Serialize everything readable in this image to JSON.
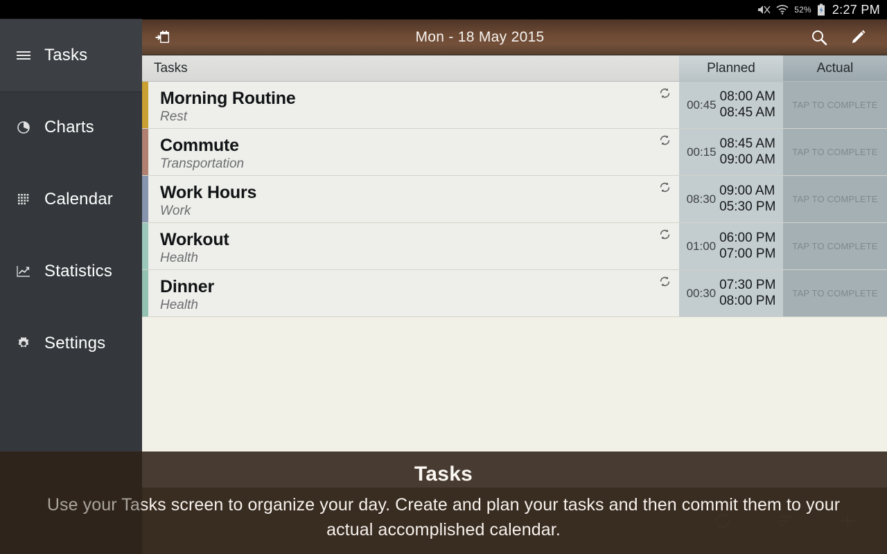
{
  "status_bar": {
    "mute_icon": "mute-icon",
    "wifi_icon": "wifi-icon",
    "battery_percent": "52%",
    "battery_icon": "battery-charging-icon",
    "clock": "2:27 PM"
  },
  "sidebar": {
    "items": [
      {
        "label": "Tasks",
        "icon": "hamburger-menu-icon",
        "active": true
      },
      {
        "label": "Charts",
        "icon": "pie-chart-icon",
        "active": false
      },
      {
        "label": "Calendar",
        "icon": "calendar-grid-icon",
        "active": false
      },
      {
        "label": "Statistics",
        "icon": "line-chart-icon",
        "active": false
      },
      {
        "label": "Settings",
        "icon": "gear-icon",
        "active": false
      }
    ]
  },
  "title_bar": {
    "jump_to_date_icon": "calendar-jump-icon",
    "title": "Mon - 18 May 2015",
    "search_icon": "search-icon",
    "edit_icon": "pencil-edit-icon"
  },
  "columns": {
    "tasks": "Tasks",
    "planned": "Planned",
    "actual": "Actual"
  },
  "tasks": [
    {
      "title": "Morning Routine",
      "category": "Rest",
      "color": "#c9a132",
      "repeat_icon": "repeat-icon",
      "duration": "00:45",
      "start": "08:00 AM",
      "end": "08:45 AM",
      "actual": "TAP TO COMPLETE"
    },
    {
      "title": "Commute",
      "category": "Transportation",
      "color": "#b08171",
      "repeat_icon": "repeat-icon",
      "duration": "00:15",
      "start": "08:45 AM",
      "end": "09:00 AM",
      "actual": "TAP TO COMPLETE"
    },
    {
      "title": "Work Hours",
      "category": "Work",
      "color": "#8794ad",
      "repeat_icon": "repeat-icon",
      "duration": "08:30",
      "start": "09:00 AM",
      "end": "05:30 PM",
      "actual": "TAP TO COMPLETE"
    },
    {
      "title": "Workout",
      "category": "Health",
      "color": "#9cc8bb",
      "repeat_icon": "repeat-icon",
      "duration": "01:00",
      "start": "06:00 PM",
      "end": "07:00 PM",
      "actual": "TAP TO COMPLETE"
    },
    {
      "title": "Dinner",
      "category": "Health",
      "color": "#93c2b2",
      "repeat_icon": "repeat-icon",
      "duration": "00:30",
      "start": "07:30 PM",
      "end": "08:00 PM",
      "actual": "TAP TO COMPLETE"
    }
  ],
  "bottom_bar": {
    "icons": [
      {
        "name": "sync-icon"
      },
      {
        "name": "sort-icon"
      },
      {
        "name": "add-task-icon"
      }
    ]
  },
  "overlay": {
    "title": "Tasks",
    "body": "Use your Tasks screen to organize your day. Create and plan your tasks and then commit them to your actual accomplished calendar."
  },
  "theme": {
    "accent_brown": "#6d4a34",
    "sidebar_bg": "#34383c",
    "list_bg": "#f2f1e8",
    "planned_bg": "#c3ccce",
    "actual_bg": "#a5b0b5"
  }
}
